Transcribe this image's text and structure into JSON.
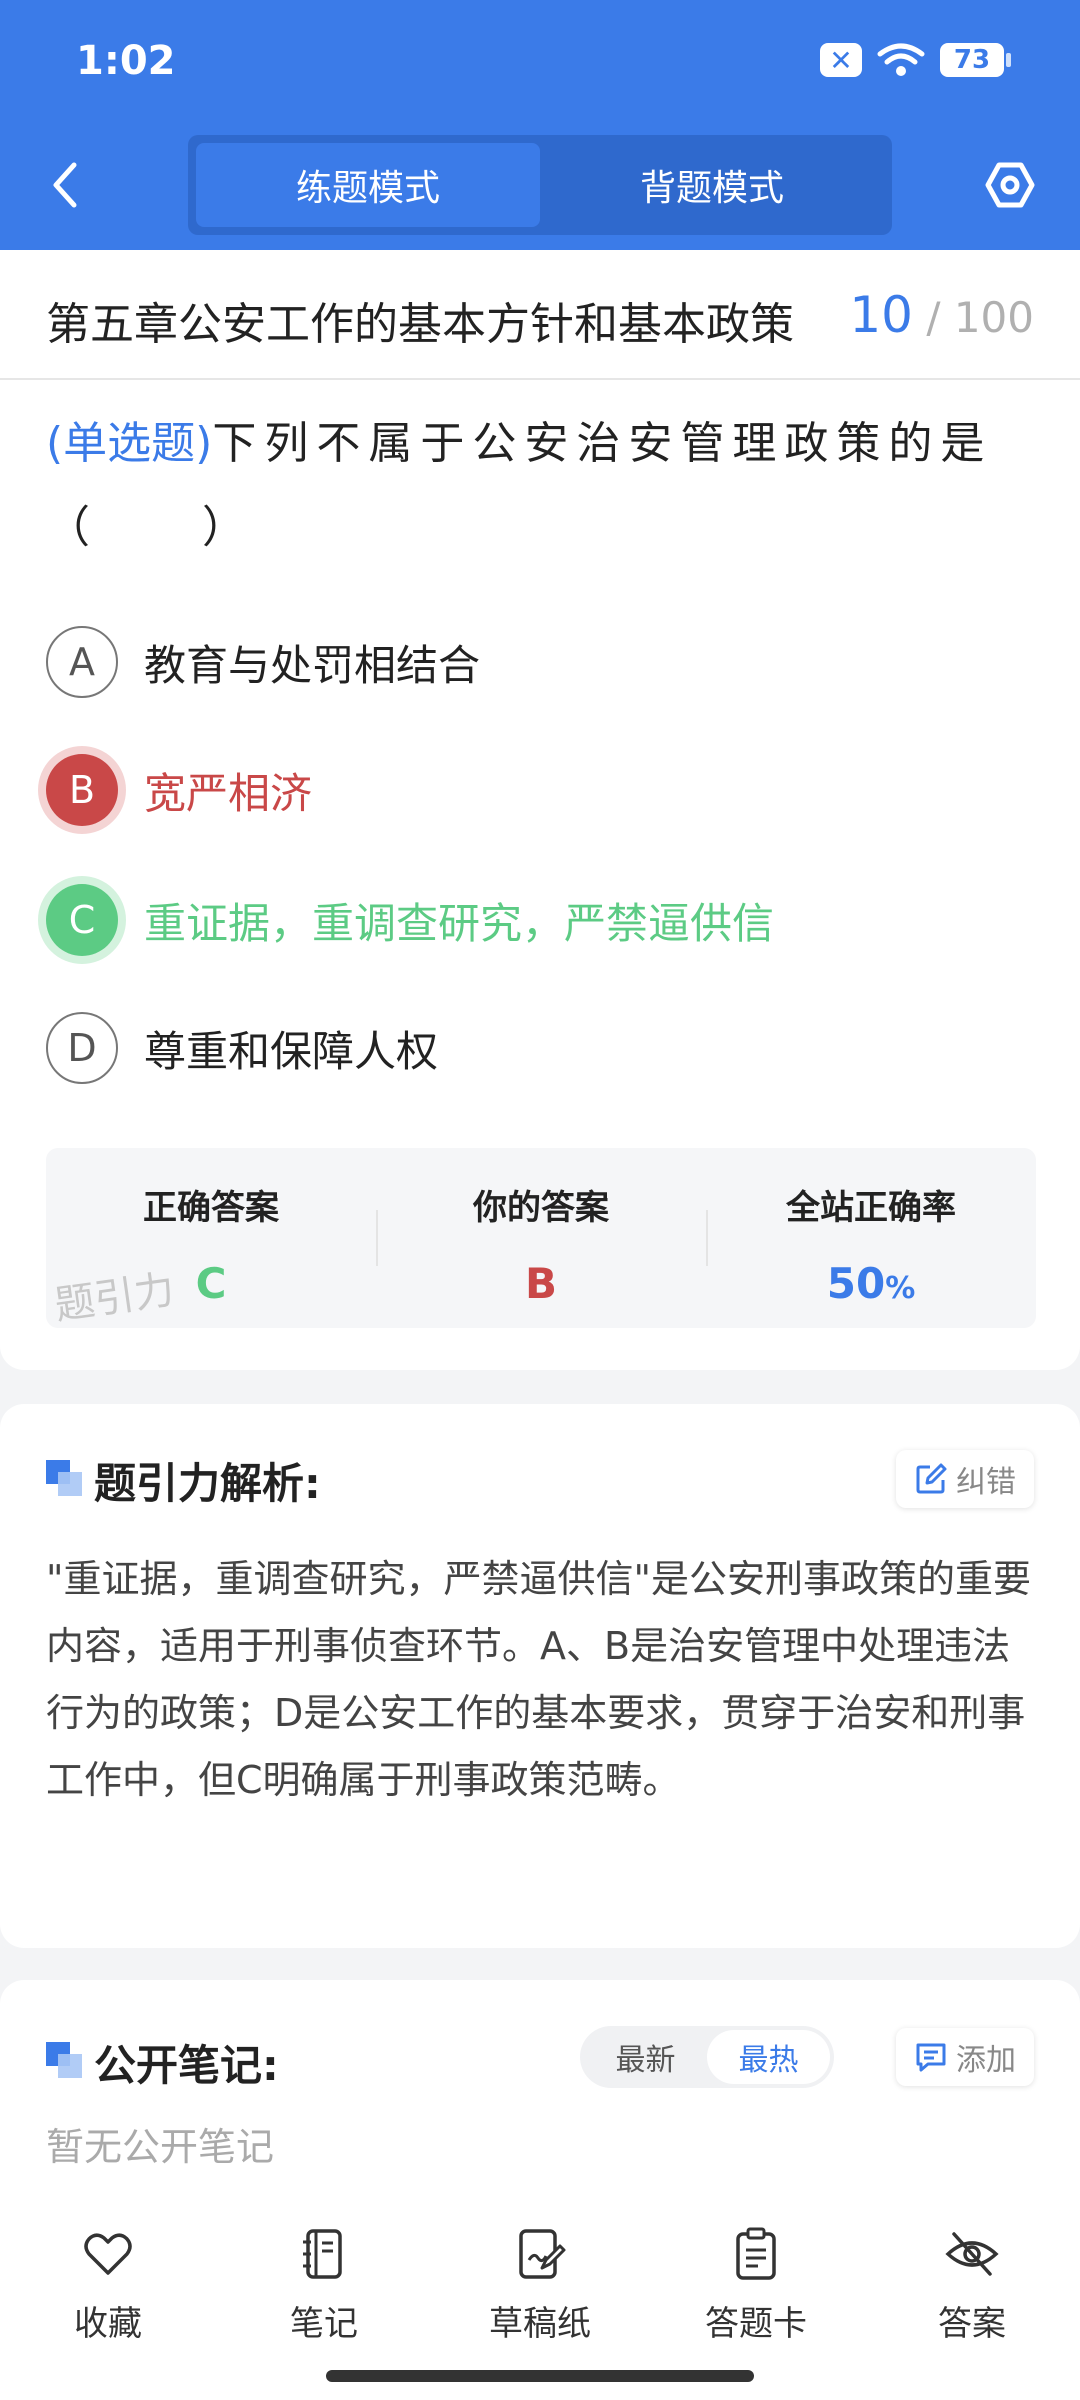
{
  "status_bar": {
    "time": "1:02",
    "battery": "73"
  },
  "header": {
    "tabs": [
      {
        "label": "练题模式",
        "active": true
      },
      {
        "label": "背题模式",
        "active": false
      }
    ]
  },
  "chapter": {
    "title": "第五章公安工作的基本方针和基本政策",
    "current": "10",
    "total": "/ 100"
  },
  "question": {
    "type": "(单选题)",
    "text": "下列不属于公安治安管理政策的是（　　）"
  },
  "options": [
    {
      "letter": "A",
      "text": "教育与处罚相结合",
      "state": "normal"
    },
    {
      "letter": "B",
      "text": "宽严相济",
      "state": "wrong"
    },
    {
      "letter": "C",
      "text": "重证据，重调查研究，严禁逼供信",
      "state": "right"
    },
    {
      "letter": "D",
      "text": "尊重和保障人权",
      "state": "normal"
    }
  ],
  "answer_box": {
    "correct_label": "正确答案",
    "correct_value": "C",
    "yours_label": "你的答案",
    "yours_value": "B",
    "rate_label": "全站正确率",
    "rate_value": "50",
    "rate_unit": "%",
    "watermark": "题引力"
  },
  "analysis": {
    "title": "题引力解析:",
    "report_label": "纠错",
    "text": "\"重证据，重调查研究，严禁逼供信\"是公安刑事政策的重要内容，适用于刑事侦查环节。A、B是治安管理中处理违法行为的政策；D是公安工作的基本要求，贯穿于治安和刑事工作中，但C明确属于刑事政策范畴。"
  },
  "notes": {
    "title": "公开笔记:",
    "sort_tabs": [
      {
        "label": "最新",
        "active": false
      },
      {
        "label": "最热",
        "active": true
      }
    ],
    "add_label": "添加",
    "empty_text": "暂无公开笔记"
  },
  "bottom_nav": [
    {
      "label": "收藏",
      "icon": "heart-icon"
    },
    {
      "label": "笔记",
      "icon": "notebook-icon"
    },
    {
      "label": "草稿纸",
      "icon": "draft-paper-icon"
    },
    {
      "label": "答题卡",
      "icon": "answer-sheet-icon"
    },
    {
      "label": "答案",
      "icon": "eye-off-icon"
    }
  ],
  "colors": {
    "primary": "#3b7be8",
    "wrong": "#c94848",
    "right": "#5ccb84"
  }
}
